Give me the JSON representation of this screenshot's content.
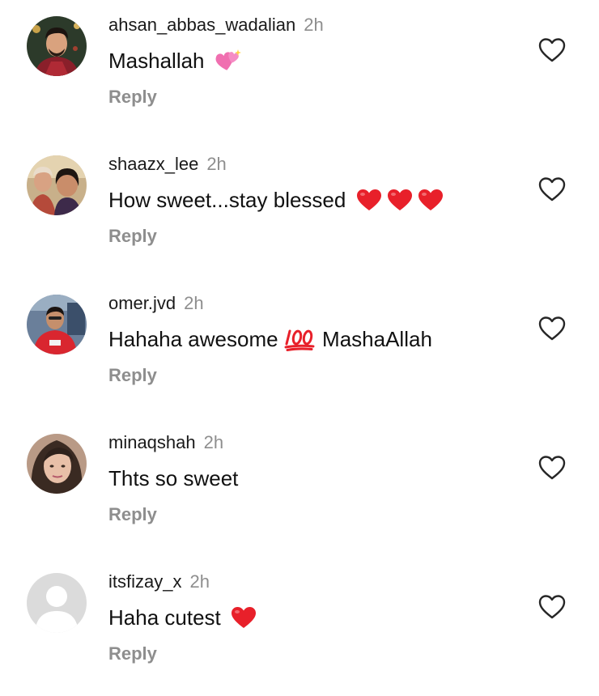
{
  "comments": [
    {
      "username": "ahsan_abbas_wadalian",
      "time": "2h",
      "text": "Mashallah",
      "emojis": [
        "sparkling-heart"
      ],
      "reply_label": "Reply",
      "avatar": "profile-photo"
    },
    {
      "username": "shaazx_lee",
      "time": "2h",
      "text": "How sweet...stay blessed",
      "emojis": [
        "red-heart",
        "red-heart",
        "red-heart"
      ],
      "reply_label": "Reply",
      "avatar": "profile-photo"
    },
    {
      "username": "omer.jvd",
      "time": "2h",
      "text_before": "Hahaha awesome",
      "text_after": "MashaAllah",
      "emojis": [
        "hundred-points"
      ],
      "reply_label": "Reply",
      "avatar": "profile-photo"
    },
    {
      "username": "minaqshah",
      "time": "2h",
      "text": "Thts so sweet",
      "emojis": [],
      "reply_label": "Reply",
      "avatar": "profile-photo"
    },
    {
      "username": "itsfizay_x",
      "time": "2h",
      "text": "Haha cutest",
      "emojis": [
        "red-heart"
      ],
      "reply_label": "Reply",
      "avatar": "default-avatar"
    }
  ],
  "colors": {
    "text": "#111111",
    "secondary": "#8e8e8e",
    "heart_red": "#e8202a",
    "background": "#ffffff"
  }
}
